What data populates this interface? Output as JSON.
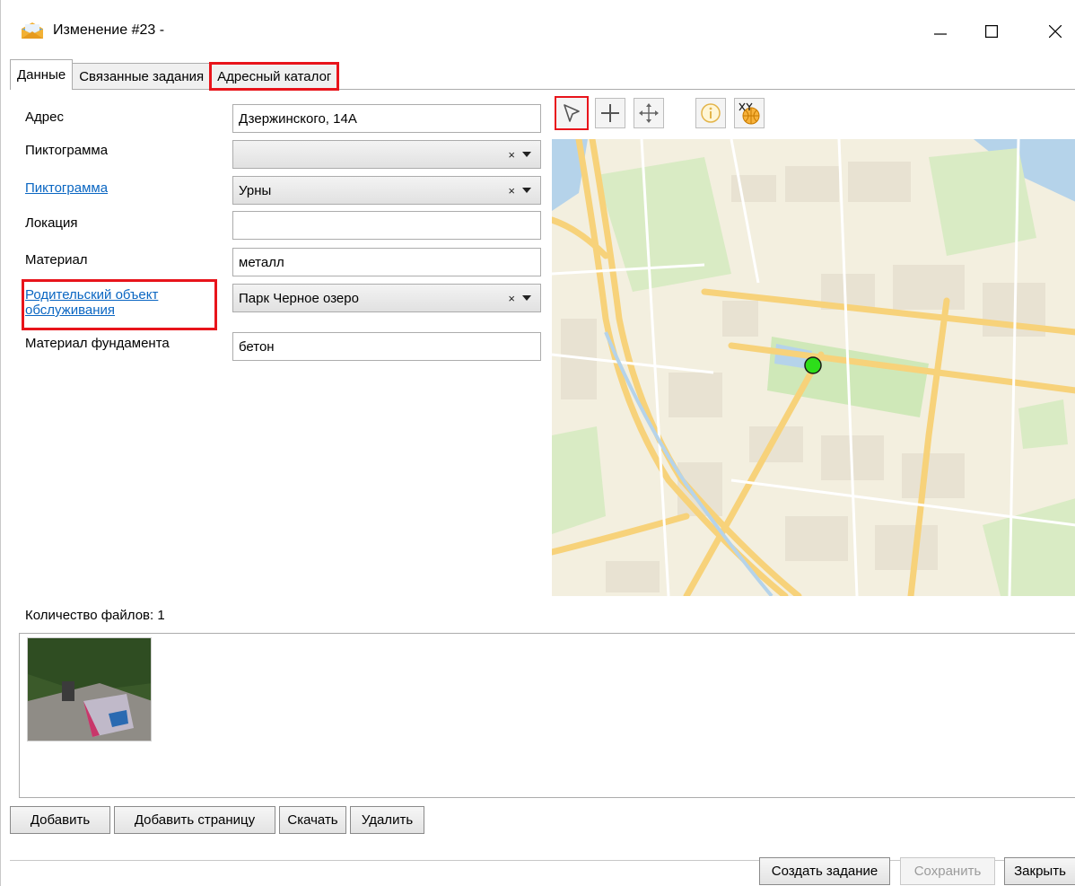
{
  "window": {
    "title": "Изменение #23 -",
    "app_icon": "envelope-icon",
    "controls": [
      "minimize-icon",
      "maximize-icon",
      "close-icon"
    ]
  },
  "tabs": [
    {
      "label": "Данные",
      "active": true
    },
    {
      "label": "Связанные задания",
      "active": false
    },
    {
      "label": "Адресный каталог",
      "active": false
    }
  ],
  "form": {
    "address_label": "Адрес",
    "address_value": "Дзержинского, 14А",
    "pictogram1_label": "Пиктограмма",
    "pictogram1_value": "",
    "pictogram2_label": "Пиктограмма",
    "pictogram2_value": "Урны",
    "location_label": "Локация",
    "location_value": "",
    "material_label": "Материал",
    "material_value": "металл",
    "parent_label_line1": "Родительский объект",
    "parent_label_line2": "обслуживания",
    "parent_value": "Парк Черное озеро",
    "foundation_label": "Материал фундамента",
    "foundation_value": "бетон",
    "clear_glyph": "×"
  },
  "map_tools": [
    "select-arrow-icon",
    "add-point-icon",
    "pan-icon",
    "info-icon",
    "xy-coordinates-icon"
  ],
  "map": {
    "colors": {
      "background": "#f3efdf",
      "park": "#cfe8b8",
      "road": "#f7d27a",
      "water": "#b5d3ea",
      "marker": "#2dde1a"
    }
  },
  "files": {
    "count_label": "Количество файлов: 1"
  },
  "file_buttons": {
    "add": "Добавить",
    "add_page": "Добавить страницу",
    "download": "Скачать",
    "delete": "Удалить"
  },
  "footer_buttons": {
    "create_task": "Создать задание",
    "save": "Сохранить",
    "close": "Закрыть"
  },
  "accent": {
    "highlight": "#e8141b",
    "link": "#0a66c2"
  }
}
